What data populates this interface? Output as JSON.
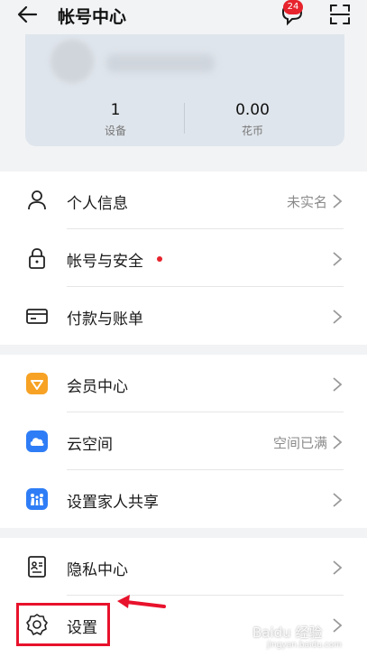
{
  "header": {
    "title": "帐号中心",
    "message_count": "24",
    "icons": {
      "back": "back-arrow-icon",
      "messages": "message-bubble-icon",
      "scan": "scan-icon"
    }
  },
  "profile": {
    "stats": [
      {
        "value": "1",
        "label": "设备"
      },
      {
        "value": "0.00",
        "label": "花币"
      }
    ]
  },
  "sections": [
    {
      "rows": [
        {
          "label": "个人信息",
          "value": "未实名",
          "icon": "person-icon"
        },
        {
          "label": "帐号与安全",
          "value": "",
          "icon": "lock-icon",
          "dot": true
        },
        {
          "label": "付款与账单",
          "value": "",
          "icon": "card-icon"
        }
      ]
    },
    {
      "rows": [
        {
          "label": "会员中心",
          "value": "",
          "icon": "member-icon"
        },
        {
          "label": "云空间",
          "value": "空间已满",
          "icon": "cloud-icon"
        },
        {
          "label": "设置家人共享",
          "value": "",
          "icon": "family-share-icon"
        }
      ]
    },
    {
      "rows": [
        {
          "label": "隐私中心",
          "value": "",
          "icon": "privacy-icon"
        },
        {
          "label": "设置",
          "value": "",
          "icon": "gear-icon"
        }
      ]
    }
  ],
  "colors": {
    "accent_red": "#e7232d",
    "highlight_red": "#e8122c",
    "member_orange": "#f7a224",
    "cloud_blue": "#2f7df6"
  },
  "watermark": {
    "text": "Baidu 经验",
    "sub": "jingyan.baidu.com"
  }
}
